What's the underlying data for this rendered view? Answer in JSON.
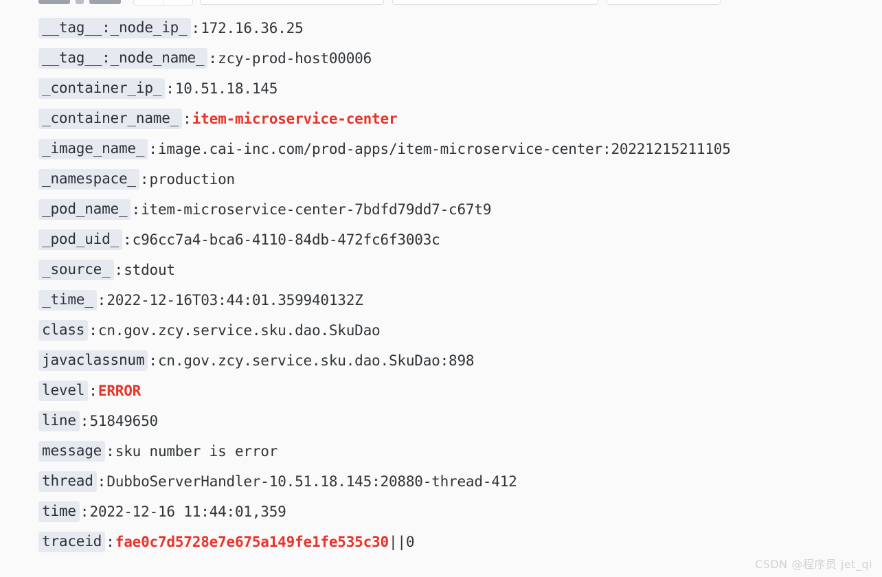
{
  "toolbar": {
    "visible_fragment": true,
    "buttons": [
      "copy-button",
      "download-button",
      "more-button"
    ],
    "segmented_control": [
      "seg-left",
      "seg-right"
    ],
    "fields": [
      "search-field",
      "filter-field",
      "range-field"
    ]
  },
  "log_detail": {
    "fields": [
      {
        "key": "__tag__:_node_ip_",
        "value": "172.16.36.25",
        "highlight": false,
        "suffix": ""
      },
      {
        "key": "__tag__:_node_name_",
        "value": "zcy-prod-host00006",
        "highlight": false,
        "suffix": ""
      },
      {
        "key": "_container_ip_",
        "value": "10.51.18.145",
        "highlight": false,
        "suffix": ""
      },
      {
        "key": "_container_name_",
        "value": "item-microservice-center",
        "highlight": true,
        "suffix": ""
      },
      {
        "key": "_image_name_",
        "value": "image.cai-inc.com/prod-apps/item-microservice-center:20221215211105",
        "highlight": false,
        "suffix": ""
      },
      {
        "key": "_namespace_",
        "value": "production",
        "highlight": false,
        "suffix": ""
      },
      {
        "key": "_pod_name_",
        "value": "item-microservice-center-7bdfd79dd7-c67t9",
        "highlight": false,
        "suffix": ""
      },
      {
        "key": "_pod_uid_",
        "value": "c96cc7a4-bca6-4110-84db-472fc6f3003c",
        "highlight": false,
        "suffix": ""
      },
      {
        "key": "_source_",
        "value": "stdout",
        "highlight": false,
        "suffix": ""
      },
      {
        "key": "_time_",
        "value": "2022-12-16T03:44:01.359940132Z",
        "highlight": false,
        "suffix": ""
      },
      {
        "key": "class",
        "value": "cn.gov.zcy.service.sku.dao.SkuDao",
        "highlight": false,
        "suffix": ""
      },
      {
        "key": "javaclassnum",
        "value": "cn.gov.zcy.service.sku.dao.SkuDao:898",
        "highlight": false,
        "suffix": ""
      },
      {
        "key": "level",
        "value": "ERROR",
        "highlight": true,
        "suffix": ""
      },
      {
        "key": "line",
        "value": "51849650",
        "highlight": false,
        "suffix": ""
      },
      {
        "key": "message",
        "value": "sku number is error",
        "highlight": false,
        "suffix": ""
      },
      {
        "key": "thread",
        "value": "DubboServerHandler-10.51.18.145:20880-thread-412",
        "highlight": false,
        "suffix": ""
      },
      {
        "key": "time",
        "value": "2022-12-16 11:44:01,359",
        "highlight": false,
        "suffix": ""
      },
      {
        "key": "traceid",
        "value": "fae0c7d5728e7e675a149fe1fe535c30",
        "highlight": true,
        "suffix": "||0"
      }
    ],
    "colon": ":"
  },
  "colors": {
    "page_background": "#fafafa",
    "key_chip_background": "#e6eaf0",
    "key_text": "#2b3036",
    "value_text": "#2f3438",
    "highlight_red": "#e8332a",
    "watermark_text": "#d2d2d2"
  },
  "watermark": {
    "text": "CSDN @程序员 jet_qi"
  }
}
